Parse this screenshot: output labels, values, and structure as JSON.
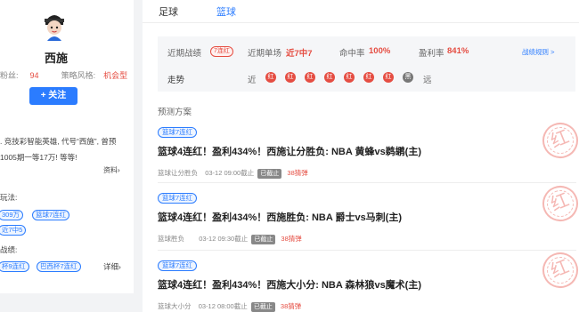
{
  "profile": {
    "name": "西施",
    "stats_text": "粉丝:",
    "fans": "94",
    "style_label": "策略风格:",
    "style_value": "机会型",
    "follow_label": "+ 关注",
    "intro_lines": [
      ". 竞技彩智能英雄, 代号“西施”, 曾预",
      "1005期一等17万! 等等!"
    ],
    "more_intro": "资料",
    "more_intro_arrow": "›",
    "method_label": "玩法:",
    "method_tags": [
      "309万",
      "篮球7连红",
      "近7中5"
    ],
    "record_label": "战绩:",
    "record_tags": [
      "杯9连红",
      "巴西杯7连红"
    ],
    "more_record": "详细",
    "more_record_arrow": "›"
  },
  "tabs": [
    "足球",
    "篮球"
  ],
  "summary": {
    "recent_label": "近期战绩",
    "recent_badge": "7连红",
    "single_label": "近期单场",
    "single_value": "近7中7",
    "hit_label": "命中率",
    "hit_value": "100%",
    "profit_label": "盈利率",
    "profit_value": "841%",
    "rule_link": "战绩规则 >",
    "trend_label": "走势",
    "near": "近",
    "far": "远",
    "trend": [
      "红",
      "红",
      "红",
      "红",
      "红",
      "红",
      "红",
      "黑"
    ]
  },
  "section_title": "预测方案",
  "items": [
    {
      "tag": "篮球7连红",
      "title": "篮球4连红！盈利434%！西施让分胜负: NBA 黄蜂vs鹈鹕(主)",
      "type": "篮球让分胜负",
      "time": "03-12 09:00截止",
      "status": "已截止",
      "price": "38猜弹",
      "stamp": "红"
    },
    {
      "tag": "篮球7连红",
      "title": "篮球4连红！盈利434%！西施胜负: NBA 爵士vs马刺(主)",
      "type": "篮球胜负",
      "time": "03-12 09:30截止",
      "status": "已截止",
      "price": "38猜弹",
      "stamp": "红"
    },
    {
      "tag": "篮球7连红",
      "title": "篮球4连红！盈利434%！西施大小分: NBA 森林狼vs魔术(主)",
      "type": "篮球大小分",
      "time": "03-12 08:00截止",
      "status": "已截止",
      "price": "38猜弹",
      "stamp": "红"
    }
  ],
  "colors": {
    "accent": "#2b7cff",
    "red": "#e54d42",
    "stamp": "#f4b1ac"
  }
}
